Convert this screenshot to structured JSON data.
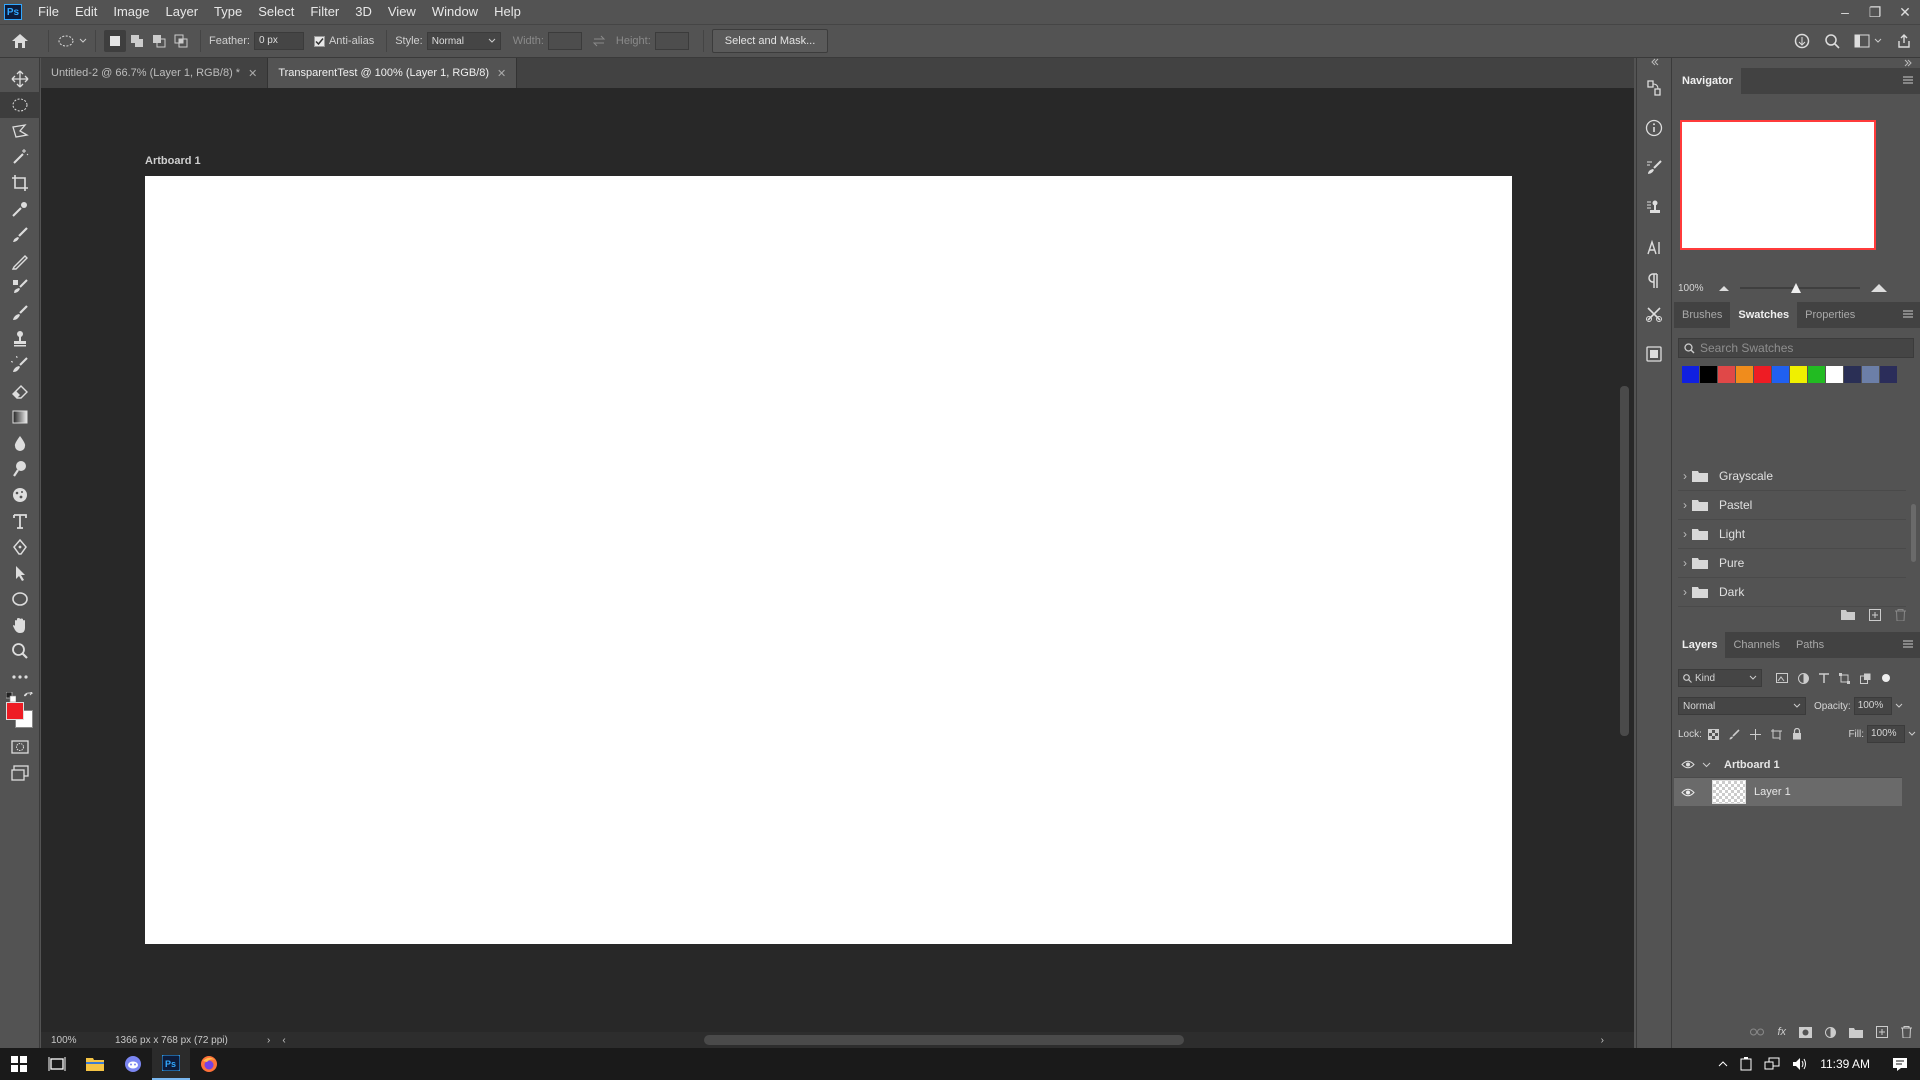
{
  "menubar": {
    "app_logo": "Ps",
    "items": [
      "File",
      "Edit",
      "Image",
      "Layer",
      "Type",
      "Select",
      "Filter",
      "3D",
      "View",
      "Window",
      "Help"
    ]
  },
  "options": {
    "feather_label": "Feather:",
    "feather_value": "0 px",
    "antialias_label": "Anti-alias",
    "antialias_checked": true,
    "style_label": "Style:",
    "style_value": "Normal",
    "width_label": "Width:",
    "height_label": "Height:",
    "select_mask_label": "Select and Mask..."
  },
  "tabs": [
    {
      "label": "Untitled-2 @ 66.7% (Layer 1, RGB/8) *",
      "active": false
    },
    {
      "label": "TransparentTest @ 100% (Layer 1, RGB/8)",
      "active": true
    }
  ],
  "document": {
    "artboard_label": "Artboard 1",
    "zoom": "100%",
    "doc_info": "1366 px x 768 px (72 ppi)"
  },
  "colors": {
    "foreground": "#ee1c24",
    "background": "#ffffff",
    "navigator_frame": "#ff3b3b"
  },
  "navigator": {
    "title": "Navigator",
    "zoom": "100%"
  },
  "swatches_panel": {
    "tabs": [
      "Brushes",
      "Swatches",
      "Properties"
    ],
    "active_tab": "Swatches",
    "search_placeholder": "Search Swatches",
    "recent": [
      "#1020e0",
      "#000000",
      "#e04848",
      "#f08c1c",
      "#ee1c24",
      "#2060f0",
      "#f0f000",
      "#22bb22",
      "#ffffff",
      "#2a2f55",
      "#6c7fa8",
      "#2b2d5a"
    ],
    "groups": [
      "Grayscale",
      "Pastel",
      "Light",
      "Pure",
      "Dark"
    ]
  },
  "layers_panel": {
    "tabs": [
      "Layers",
      "Channels",
      "Paths"
    ],
    "active_tab": "Layers",
    "filter_label": "Kind",
    "blend_mode": "Normal",
    "opacity_label": "Opacity:",
    "opacity_value": "100%",
    "lock_label": "Lock:",
    "fill_label": "Fill:",
    "fill_value": "100%",
    "layers": [
      {
        "name": "Artboard 1",
        "type": "artboard"
      },
      {
        "name": "Layer 1",
        "type": "layer"
      }
    ]
  },
  "taskbar": {
    "time": "11:39 AM"
  }
}
